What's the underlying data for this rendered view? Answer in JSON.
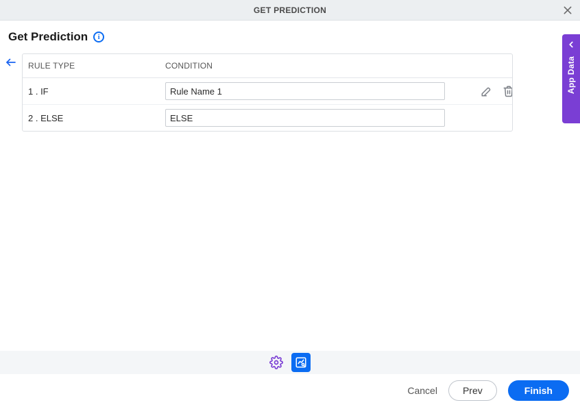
{
  "topbar": {
    "title": "GET PREDICTION"
  },
  "header": {
    "title": "Get Prediction"
  },
  "table": {
    "columns": {
      "rule_type": "RULE TYPE",
      "condition": "CONDITION"
    },
    "rows": [
      {
        "rule_type": "1 . IF",
        "condition": "Rule Name 1",
        "editable": true
      },
      {
        "rule_type": "2 . ELSE",
        "condition": "ELSE",
        "editable": false
      }
    ]
  },
  "footer": {
    "cancel": "Cancel",
    "prev": "Prev",
    "finish": "Finish"
  },
  "side_panel": {
    "label": "App Data"
  },
  "icons": {
    "close": "close-icon",
    "info": "info-icon",
    "back": "arrow-left-icon",
    "edit": "edit-icon",
    "delete": "trash-icon",
    "gear": "gear-icon",
    "preview": "chart-preview-icon",
    "chevron_left": "chevron-left-icon"
  },
  "colors": {
    "accent_blue": "#0b6cf2",
    "accent_purple": "#7a3ed4"
  }
}
